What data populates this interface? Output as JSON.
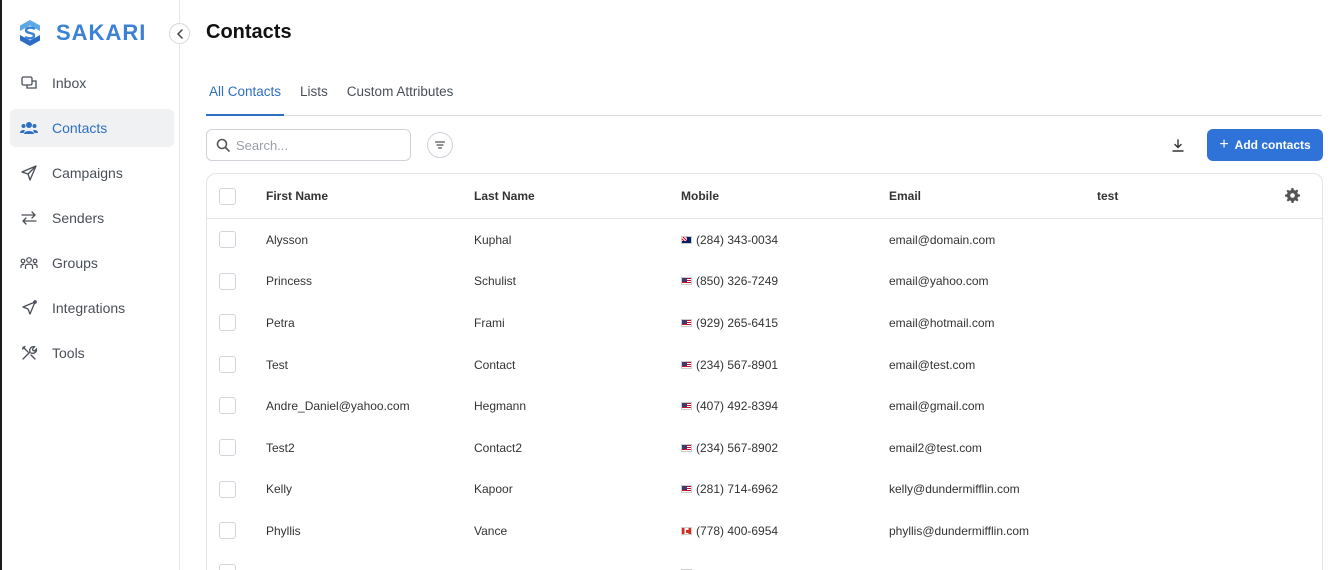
{
  "brand": {
    "name": "SAKARI"
  },
  "sidebar": {
    "items": [
      {
        "label": "Inbox",
        "icon": "inbox-icon",
        "active": false
      },
      {
        "label": "Contacts",
        "icon": "users-icon",
        "active": true
      },
      {
        "label": "Campaigns",
        "icon": "send-icon",
        "active": false
      },
      {
        "label": "Senders",
        "icon": "swap-arrows-icon",
        "active": false
      },
      {
        "label": "Groups",
        "icon": "group-icon",
        "active": false
      },
      {
        "label": "Integrations",
        "icon": "integrations-icon",
        "active": false
      },
      {
        "label": "Tools",
        "icon": "tools-icon",
        "active": false
      }
    ]
  },
  "main": {
    "title": "Contacts",
    "tabs": [
      {
        "label": "All Contacts",
        "active": true
      },
      {
        "label": "Lists",
        "active": false
      },
      {
        "label": "Custom Attributes",
        "active": false
      }
    ],
    "search": {
      "placeholder": "Search...",
      "value": ""
    },
    "add_button": "Add contacts"
  },
  "table": {
    "columns": [
      "First Name",
      "Last Name",
      "Mobile",
      "Email",
      "test"
    ],
    "rows": [
      {
        "first": "Alysson",
        "last": "Kuphal",
        "flag": "vg",
        "mobile": "(284) 343-0034",
        "email": "email@domain.com",
        "test": ""
      },
      {
        "first": "Princess",
        "last": "Schulist",
        "flag": "us",
        "mobile": "(850) 326-7249",
        "email": "email@yahoo.com",
        "test": ""
      },
      {
        "first": "Petra",
        "last": "Frami",
        "flag": "us",
        "mobile": "(929) 265-6415",
        "email": "email@hotmail.com",
        "test": ""
      },
      {
        "first": "Test",
        "last": "Contact",
        "flag": "us",
        "mobile": "(234) 567-8901",
        "email": "email@test.com",
        "test": ""
      },
      {
        "first": "Andre_Daniel@yahoo.com",
        "last": "Hegmann",
        "flag": "us",
        "mobile": "(407) 492-8394",
        "email": "email@gmail.com",
        "test": ""
      },
      {
        "first": "Test2",
        "last": "Contact2",
        "flag": "us",
        "mobile": "(234) 567-8902",
        "email": "email2@test.com",
        "test": ""
      },
      {
        "first": "Kelly",
        "last": "Kapoor",
        "flag": "us",
        "mobile": "(281) 714-6962",
        "email": "kelly@dundermifflin.com",
        "test": ""
      },
      {
        "first": "Phyllis",
        "last": "Vance",
        "flag": "ca",
        "mobile": "(778) 400-6954",
        "email": "phyllis@dundermifflin.com",
        "test": ""
      },
      {
        "first": "",
        "last": "",
        "flag": "us",
        "mobile": "",
        "email": "",
        "test": ""
      }
    ]
  },
  "colors": {
    "accent": "#2f73d8",
    "brand": "#3b82d6",
    "active_nav_bg": "#f0f1f3"
  }
}
